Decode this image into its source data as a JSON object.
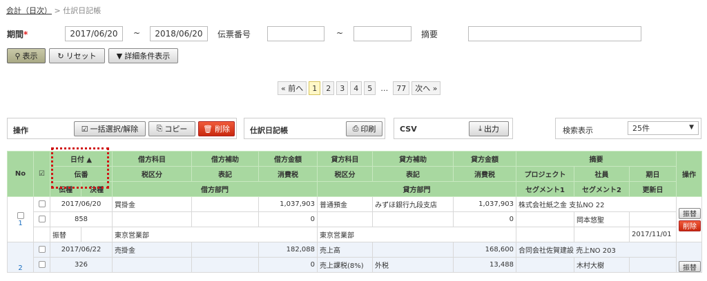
{
  "breadcrumb": {
    "root": "会計（日次）",
    "sep": ">",
    "current": "仕訳日記帳"
  },
  "filters": {
    "period_label": "期間",
    "required_mark": "*",
    "from": "2017/06/20",
    "to": "2018/06/20",
    "tilde": "~",
    "slip_no_label": "伝票番号",
    "slip_from": "",
    "slip_to": "",
    "summary_label": "摘要",
    "summary_value": ""
  },
  "actions": {
    "show": "表示",
    "reset": "リセット",
    "detail": "詳細条件表示"
  },
  "pager": {
    "prev": "« 前へ",
    "pages": [
      "1",
      "2",
      "3",
      "4",
      "5"
    ],
    "ellipsis": "…",
    "last": "77",
    "next": "次へ »"
  },
  "ops": {
    "ops_label": "操作",
    "bulk": "一括選択/解除",
    "copy": "コピー",
    "delete": "削除",
    "journal_label": "仕訳日記帳",
    "print": "印刷",
    "csv_label": "CSV",
    "export": "出力",
    "search_label": "検索表示",
    "per_page": "25件"
  },
  "header": {
    "no": "No",
    "date": "日付 ▲",
    "slip": "伝番",
    "slip_type": "伝種",
    "settle": "決種",
    "debit_account": "借方科目",
    "debit_sub": "借方補助",
    "debit_amount": "借方金額",
    "credit_account": "貸方科目",
    "credit_sub": "貸方補助",
    "credit_amount": "貸方金額",
    "summary": "摘要",
    "operation": "操作",
    "tax_class": "税区分",
    "notation": "表記",
    "tax": "消費税",
    "tax_class2": "税区分",
    "notation2": "表記",
    "tax2": "消費税",
    "project": "プロジェクト",
    "employee": "社員",
    "due": "期日",
    "debit_dept": "借方部門",
    "credit_dept": "貸方部門",
    "seg1": "セグメント1",
    "seg2": "セグメント2",
    "updated": "更新日"
  },
  "rows": [
    {
      "no": "1",
      "date": "2017/06/20",
      "slip": "858",
      "slip_type": "振替",
      "debit_account": "買掛金",
      "debit_amount": "1,037,903",
      "debit_tax": "0",
      "debit_dept": "東京営業部",
      "credit_account": "普通預金",
      "credit_sub": "みずほ銀行九段支店",
      "credit_amount": "1,037,903",
      "credit_tax": "0",
      "credit_dept": "東京営業部",
      "summary": "株式会社紙之金 支払NO 22",
      "employee": "岡本悠聖",
      "updated": "2017/11/01",
      "btn_transfer": "振替",
      "btn_delete": "削除"
    },
    {
      "no": "2",
      "date": "2017/06/22",
      "slip": "326",
      "debit_account": "売掛金",
      "debit_amount": "182,088",
      "debit_tax": "0",
      "credit_account": "売上高",
      "credit_amount": "168,600",
      "credit_tax_class": "売上課税(8%)",
      "credit_notation": "外税",
      "credit_tax": "13,488",
      "summary": "合同会社佐賀建設 売上NO 203",
      "employee": "木村大樹",
      "btn_transfer": "振替"
    }
  ]
}
